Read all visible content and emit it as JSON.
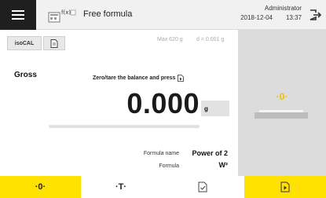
{
  "header": {
    "menu_icon": "hamburger-menu-icon",
    "app_icon": "formula-task-icon",
    "app_icon_text": "f(x)",
    "title": "Free formula",
    "user": "Administrator",
    "date": "2018-12-04",
    "time": "13:37",
    "logout_icon": "logout-icon"
  },
  "toolbar": {
    "isocal_label": "isoCAL",
    "doc_icon": "document-icon",
    "max_capacity": "Max 620 g",
    "readability": "d = 0.001 g"
  },
  "display": {
    "mode": "Gross",
    "instruction": "Zero/tare the balance and press",
    "instruction_icon": "print-doc-icon",
    "weight": "0.000",
    "unit": "g",
    "progress_fraction": 0.0
  },
  "formula": {
    "name_label": "Formula name",
    "name_value": "Power of 2",
    "formula_label": "Formula",
    "formula_value": "W²"
  },
  "side_panel": {
    "zero_indicator": "·0·",
    "icon": "weighing-pan-icon"
  },
  "bottom_bar": {
    "zero_label": "·0·",
    "tare_label": "·T·",
    "check_icon": "checklist-document-icon",
    "run_icon": "play-document-icon"
  },
  "colors": {
    "accent_yellow": "#ffe200",
    "indicator_yellow": "#e9c300",
    "menu_dark": "#1f1f1f",
    "panel_gray": "#dcdcdc"
  }
}
